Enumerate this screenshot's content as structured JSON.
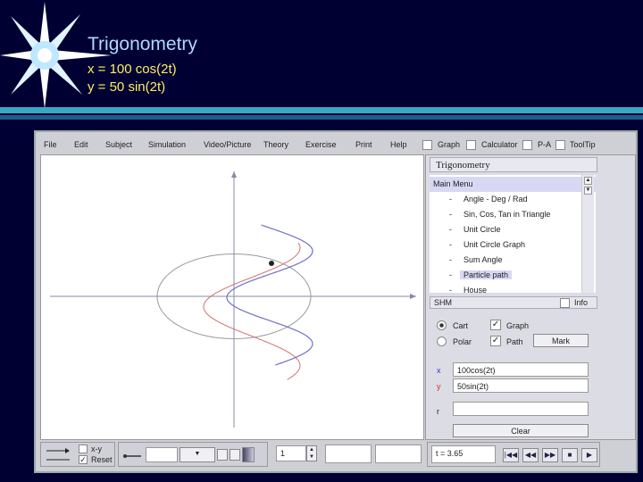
{
  "slide": {
    "title": "Trigonometry",
    "equation_x": "x = 100 cos(2t)",
    "equation_y": "y = 50 sin(2t)"
  },
  "menubar": {
    "items": [
      "File",
      "Edit",
      "Subject",
      "Simulation",
      "Video/Picture",
      "Theory",
      "Exercise",
      "Print",
      "Help"
    ],
    "checks": [
      "Graph",
      "Calculator",
      "P-A",
      "ToolTip"
    ]
  },
  "panel": {
    "title": "Trigonometry",
    "menu_header": "Main Menu",
    "items": [
      {
        "label": "Angle - Deg / Rad"
      },
      {
        "label": "Sin, Cos, Tan in Triangle"
      },
      {
        "label": "Unit Circle"
      },
      {
        "label": "Unit Circle Graph"
      },
      {
        "label": "Sum Angle"
      },
      {
        "label": "Particle path"
      },
      {
        "label": "House"
      }
    ],
    "dash": "-",
    "section": "SHM",
    "info_label": "Info",
    "cart_label": "Cart",
    "polar_label": "Polar",
    "graph_label": "Graph",
    "path_label": "Path",
    "mark_label": "Mark",
    "x_label": "x",
    "y_label": "y",
    "r_label": "r",
    "x_value": "100cos(2t)",
    "y_value": "50sin(2t)",
    "r_value": "",
    "clear_label": "Clear"
  },
  "bottom": {
    "xy_label": "x-y",
    "reset_label": "Reset",
    "step_value": "1",
    "time_readout": "t = 3.65"
  },
  "colors": {
    "accent": "#3aa7c4",
    "slide_bg": "#000033",
    "title": "#b0d8ff",
    "equation": "#ffee66",
    "ellipse": "#999999",
    "x_trace": "#d07070",
    "y_trace": "#7070c8"
  }
}
